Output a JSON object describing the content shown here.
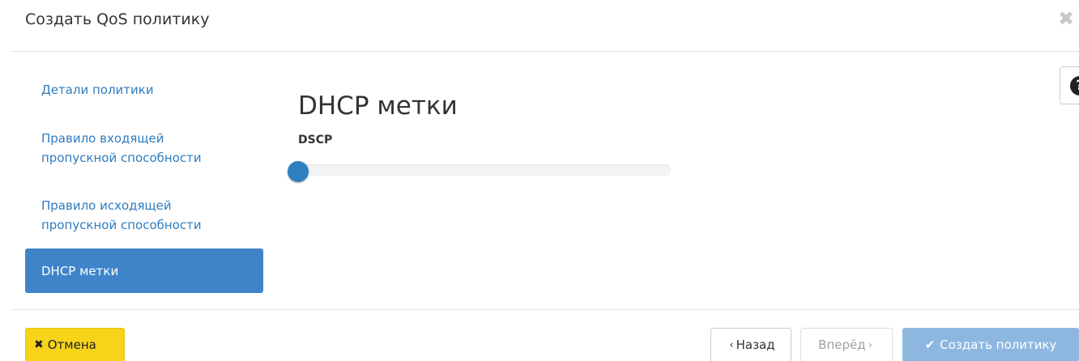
{
  "modal": {
    "title": "Создать QoS политику",
    "close_symbol": "✖"
  },
  "sidebar": {
    "items": [
      {
        "label": "Детали политики",
        "active": false
      },
      {
        "label": "Правило входящей пропускной способности",
        "active": false
      },
      {
        "label": "Правило исходящей пропускной способности",
        "active": false
      },
      {
        "label": "DHCP метки",
        "active": true
      }
    ]
  },
  "help": {
    "icon": "question-circle-icon",
    "symbol": "?"
  },
  "main": {
    "title": "DHCP метки",
    "field_label": "DSCP",
    "slider": {
      "value": 0
    }
  },
  "footer": {
    "cancel": {
      "icon": "close-icon",
      "symbol": "✖",
      "label": "Отмена"
    },
    "back": {
      "label": "Назад",
      "chevron": "‹"
    },
    "next": {
      "label": "Вперёд",
      "chevron": "›"
    },
    "create": {
      "icon": "check-icon",
      "symbol": "✔",
      "label": "Создать политику"
    }
  },
  "colors": {
    "accent": "#3f84c9",
    "link": "#2f7bbf",
    "cancel_bg": "#f7d31a",
    "create_disabled_bg": "#8db7df"
  }
}
